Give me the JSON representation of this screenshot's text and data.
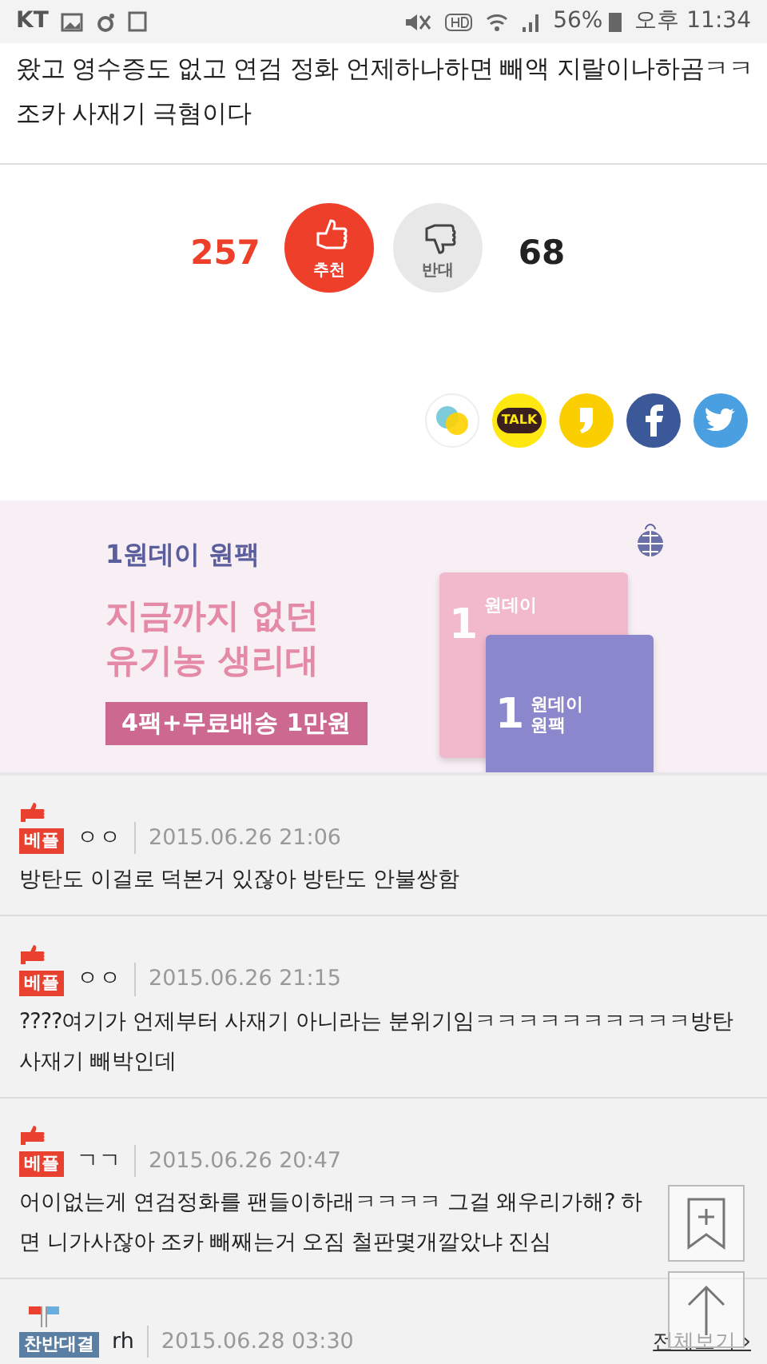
{
  "status_bar": {
    "carrier": "KT",
    "battery": "56%",
    "time": "오후 11:34"
  },
  "post": {
    "title": "왔고 영수증도 없고 연검 정화 언제하나하면 빼액 지랄이나하곰ㅋㅋ 조카 사재기 극혐이다"
  },
  "votes": [
    {
      "kind": "up",
      "count": "257",
      "label": "추천",
      "selected": true
    },
    {
      "kind": "down",
      "count": "68",
      "label": "반대",
      "selected": false
    }
  ],
  "share": [
    {
      "kind": "story"
    },
    {
      "kind": "talk",
      "text": "TALK"
    },
    {
      "kind": "comma"
    },
    {
      "kind": "facebook"
    },
    {
      "kind": "twitter"
    }
  ],
  "ad": {
    "brand": "1원데이 원팩",
    "headline": [
      "지금까지 없던",
      "유기농 생리대"
    ],
    "offer": "4팩+무료배송 1만원",
    "packs": [
      {
        "number": "1",
        "name": "원데이"
      },
      {
        "number": "1",
        "name": "원데이 원팩"
      }
    ]
  },
  "comments": [
    {
      "kind": "best",
      "badge": "베플",
      "nickname": "ㅇㅇ",
      "date": "2015.06.26 21:06",
      "text": "방탄도 이걸로 덕본거 있잖아 방탄도 안불쌍함"
    },
    {
      "kind": "best",
      "badge": "베플",
      "nickname": "ㅇㅇ",
      "date": "2015.06.26 21:15",
      "text": "????여기가 언제부터 사재기 아니라는 분위기임ㅋㅋㅋㅋㅋㅋㅋㅋㅋㅋ방탄 사재기 빼박인데"
    },
    {
      "kind": "best",
      "badge": "베플",
      "nickname": "ㄱㄱ",
      "date": "2015.06.26 20:47",
      "text": "어이없는게 연검정화를 팬들이하래ㅋㅋㅋㅋ 그걸 왜우리가해? 하면 니가사잖아 조카 빼째는거 오짐 철판몇개깔았냐 진심"
    },
    {
      "kind": "debate",
      "badge": "찬반대결",
      "nickname": "rh",
      "date": "2015.06.28 03:30",
      "link": "전체보기",
      "chevron": "›"
    }
  ]
}
